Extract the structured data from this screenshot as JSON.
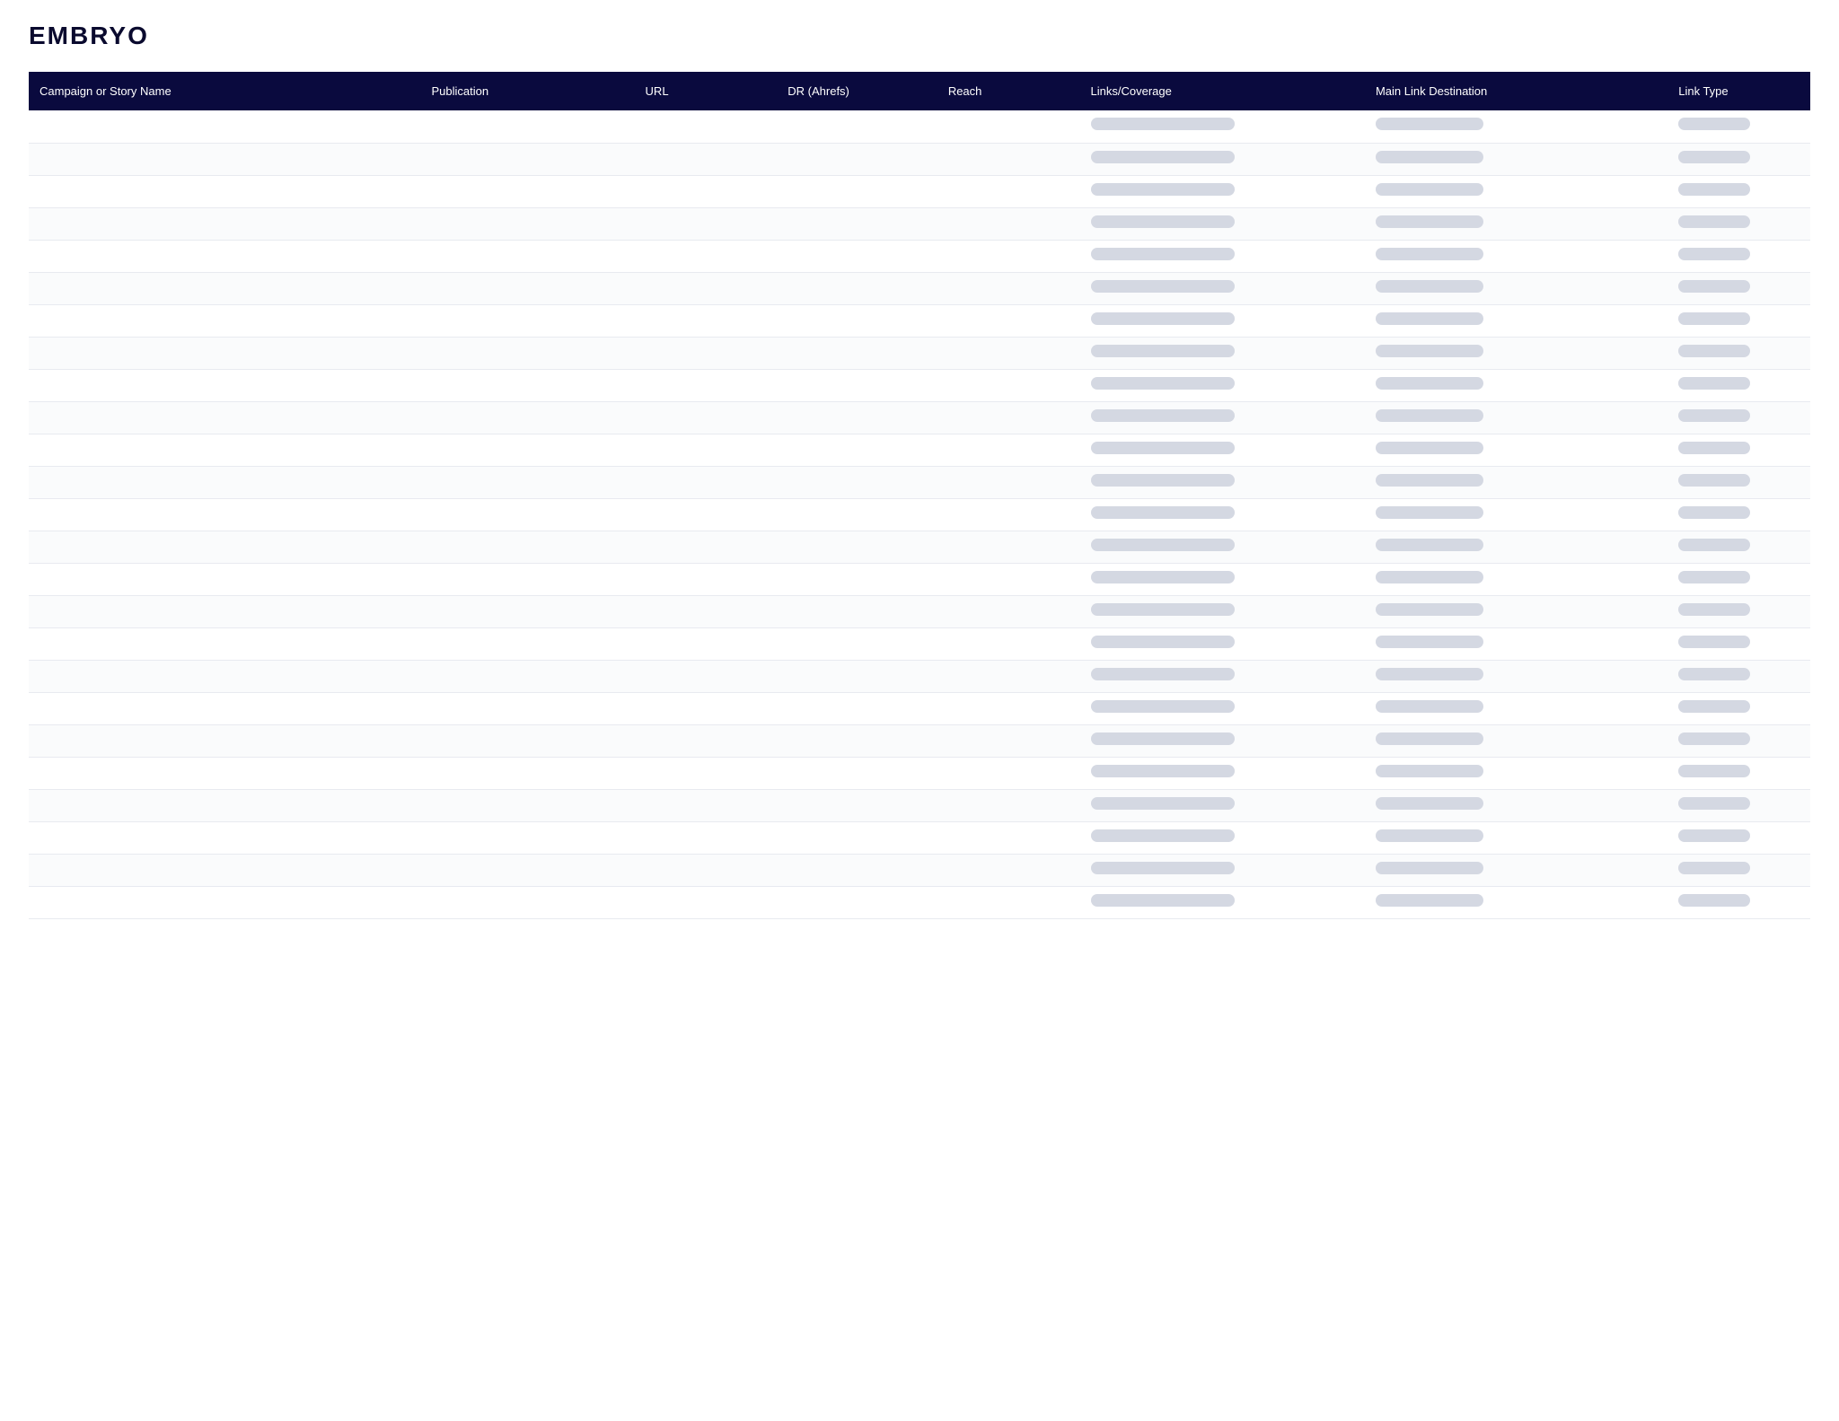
{
  "logo": {
    "text": "EMBRYO"
  },
  "table": {
    "headers": [
      {
        "key": "campaign",
        "label": "Campaign or Story Name"
      },
      {
        "key": "publication",
        "label": "Publication"
      },
      {
        "key": "url",
        "label": "URL"
      },
      {
        "key": "dr",
        "label": "DR (Ahrefs)"
      },
      {
        "key": "reach",
        "label": "Reach"
      },
      {
        "key": "links",
        "label": "Links/Coverage"
      },
      {
        "key": "destination",
        "label": "Main Link Destination"
      },
      {
        "key": "linktype",
        "label": "Link Type"
      }
    ],
    "row_count": 25
  },
  "colors": {
    "header_bg": "#0a0a3e",
    "header_text": "#ffffff",
    "pill_bg": "#d4d8e2",
    "row_border": "#e8eaf0"
  }
}
